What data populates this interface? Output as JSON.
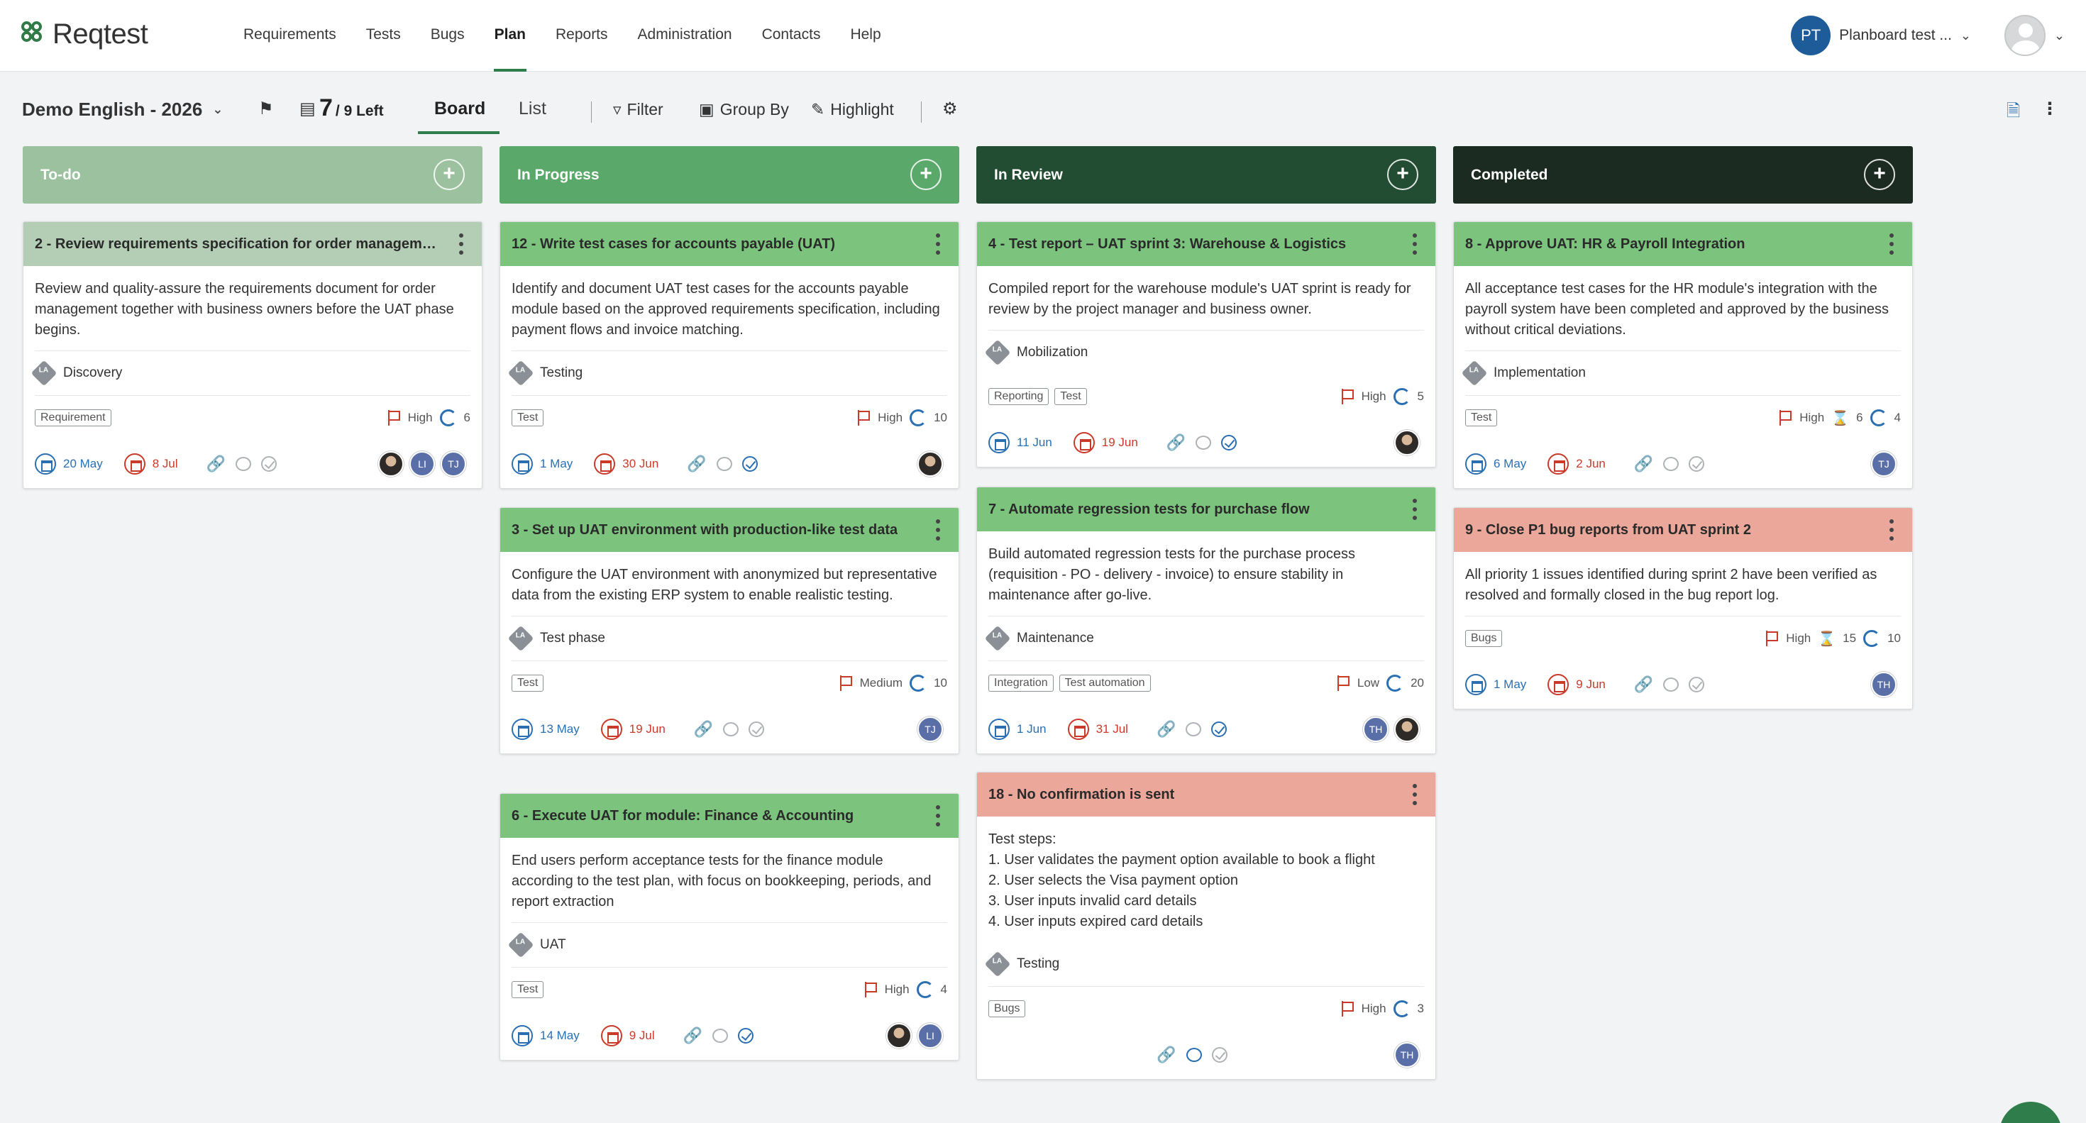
{
  "app": {
    "logo_text": "Reqtest"
  },
  "nav": {
    "items": [
      "Requirements",
      "Tests",
      "Bugs",
      "Plan",
      "Reports",
      "Administration",
      "Contacts",
      "Help"
    ],
    "active": "Plan"
  },
  "user": {
    "initials": "PT",
    "name": "Planboard test ..."
  },
  "toolbar": {
    "project": "Demo English - 2026",
    "sprint_count": "7",
    "sprint_left": "/ 9 Left",
    "board_tab": "Board",
    "list_tab": "List",
    "filter": "Filter",
    "group_by": "Group By",
    "highlight": "Highlight"
  },
  "columns": [
    {
      "name": "To-do",
      "color": "#9cc19e",
      "cards": [
        {
          "title": "2 - Review requirements specification for order manageme...",
          "head_color": "#b3ceb5",
          "description": "Review and quality-assure the requirements document for order management together with business owners before the UAT phase begins.",
          "phase": "Discovery",
          "tags": [
            "Requirement"
          ],
          "priority": "High",
          "cycles": "6",
          "start": "20 May",
          "due": "8 Jul",
          "avatars": [
            "photo",
            "LI",
            "TJ"
          ]
        }
      ]
    },
    {
      "name": "In Progress",
      "color": "#5aa86a",
      "cards": [
        {
          "title": "12 - Write test cases for accounts payable (UAT)",
          "head_color": "#7cc47e",
          "description": "Identify and document UAT test cases for the accounts payable module based on the approved requirements specification, including payment flows and invoice matching.",
          "phase": "Testing",
          "tags": [
            "Test"
          ],
          "priority": "High",
          "cycles": "10",
          "start": "1 May",
          "due": "30 Jun",
          "avatars": [
            "photo"
          ]
        },
        {
          "title": "3 - Set up UAT environment with production-like test data",
          "head_color": "#7cc47e",
          "description": "Configure the UAT environment with anonymized but representative data from the existing ERP system to enable realistic testing.",
          "phase": "Test phase",
          "tags": [
            "Test"
          ],
          "priority": "Medium",
          "cycles": "10",
          "start": "13 May",
          "due": "19 Jun",
          "avatars": [
            "TJ"
          ]
        },
        {
          "title": "6 - Execute UAT for module: Finance & Accounting",
          "head_color": "#7cc47e",
          "description": "End users perform acceptance tests for the finance module according to the test plan, with focus on bookkeeping, periods, and report extraction",
          "phase": "UAT",
          "tags": [
            "Test"
          ],
          "priority": "High",
          "cycles": "4",
          "start": "14 May",
          "due": "9 Jul",
          "avatars": [
            "photo",
            "LI"
          ]
        }
      ]
    },
    {
      "name": "In Review",
      "color": "#234d32",
      "cards": [
        {
          "title": "4 - Test report – UAT sprint 3: Warehouse & Logistics",
          "head_color": "#7cc47e",
          "description": "Compiled report for the warehouse module's UAT sprint is ready for review by the project manager and business owner.",
          "phase": "Mobilization",
          "tags": [
            "Reporting",
            "Test"
          ],
          "priority": "High",
          "cycles": "5",
          "start": "11 Jun",
          "due": "19 Jun",
          "avatars": [
            "photo"
          ]
        },
        {
          "title": "7 - Automate regression tests for purchase flow",
          "head_color": "#7cc47e",
          "description": "Build automated regression tests for the purchase process (requisition - PO - delivery - invoice) to ensure stability in maintenance after go-live.",
          "phase": "Maintenance",
          "tags": [
            "Integration",
            "Test automation"
          ],
          "priority": "Low",
          "cycles": "20",
          "start": "1 Jun",
          "due": "31 Jul",
          "avatars": [
            "TH",
            "photo"
          ]
        },
        {
          "title": "18 - No confirmation is sent",
          "head_color": "#eba79a",
          "description": "Test steps:\n1. User validates the payment option available to book a flight\n2. User selects the Visa payment option\n3. User inputs invalid card details\n4. User inputs expired card details",
          "phase": "Testing",
          "tags": [
            "Bugs"
          ],
          "priority": "High",
          "cycles": "3",
          "start": "",
          "due": "",
          "avatars": [
            "TH"
          ]
        }
      ]
    },
    {
      "name": "Completed",
      "color": "#1c2b22",
      "cards": [
        {
          "title": "8 - Approve UAT: HR & Payroll Integration",
          "head_color": "#7cc47e",
          "description": "All acceptance test cases for the HR module's integration with the payroll system have been completed and approved by the business without critical deviations.",
          "phase": "Implementation",
          "tags": [
            "Test"
          ],
          "priority": "High",
          "estimate": "6",
          "cycles": "4",
          "start": "6 May",
          "due": "2 Jun",
          "avatars": [
            "TJ"
          ]
        },
        {
          "title": "9 - Close P1 bug reports from UAT sprint 2",
          "head_color": "#eba79a",
          "description": "All priority 1 issues identified during sprint 2 have been verified as resolved and formally closed in the bug report log.",
          "phase": "",
          "tags": [
            "Bugs"
          ],
          "priority": "High",
          "estimate": "15",
          "cycles": "10",
          "start": "1 May",
          "due": "9 Jun",
          "avatars": [
            "TH"
          ]
        }
      ]
    }
  ]
}
